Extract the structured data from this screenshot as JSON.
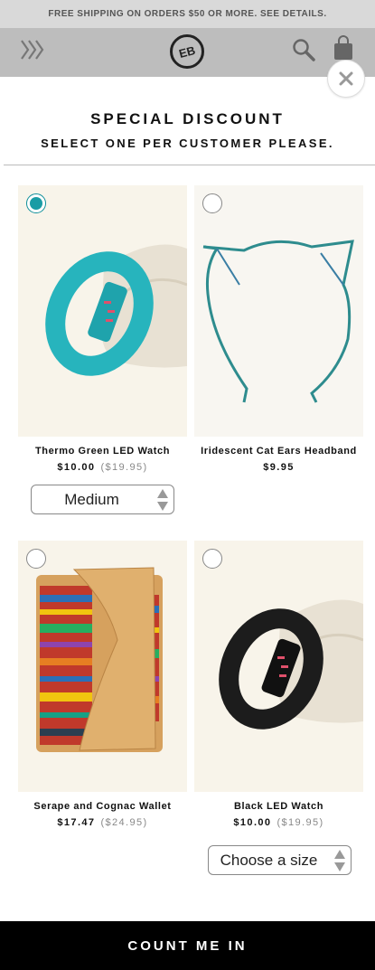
{
  "banner": {
    "text": "FREE SHIPPING ON ORDERS $50 OR MORE. SEE DETAILS."
  },
  "header": {
    "logo_text": "EB"
  },
  "modal": {
    "title": "SPECIAL DISCOUNT",
    "subtitle": "SELECT ONE PER CUSTOMER PLEASE."
  },
  "products": [
    {
      "name": "Thermo Green LED Watch",
      "price": "$10.00",
      "old_price": "($19.95)",
      "selected": true,
      "size": "Medium"
    },
    {
      "name": "Iridescent Cat Ears Headband",
      "price": "$9.95",
      "old_price": "",
      "selected": false
    },
    {
      "name": "Serape and Cognac Wallet",
      "price": "$17.47",
      "old_price": "($24.95)",
      "selected": false
    },
    {
      "name": "Black LED Watch",
      "price": "$10.00",
      "old_price": "($19.95)",
      "selected": false,
      "size": "Choose a size"
    }
  ],
  "cta": {
    "label": "COUNT ME IN"
  },
  "colors": {
    "accent": "#1a9ca5",
    "banner_bg": "#d9d9d9",
    "header_bg": "#bdbdbd",
    "cta_bg": "#000000"
  },
  "icons": [
    "menu-chevrons-icon",
    "search-icon",
    "shopping-bag-icon",
    "close-icon"
  ]
}
